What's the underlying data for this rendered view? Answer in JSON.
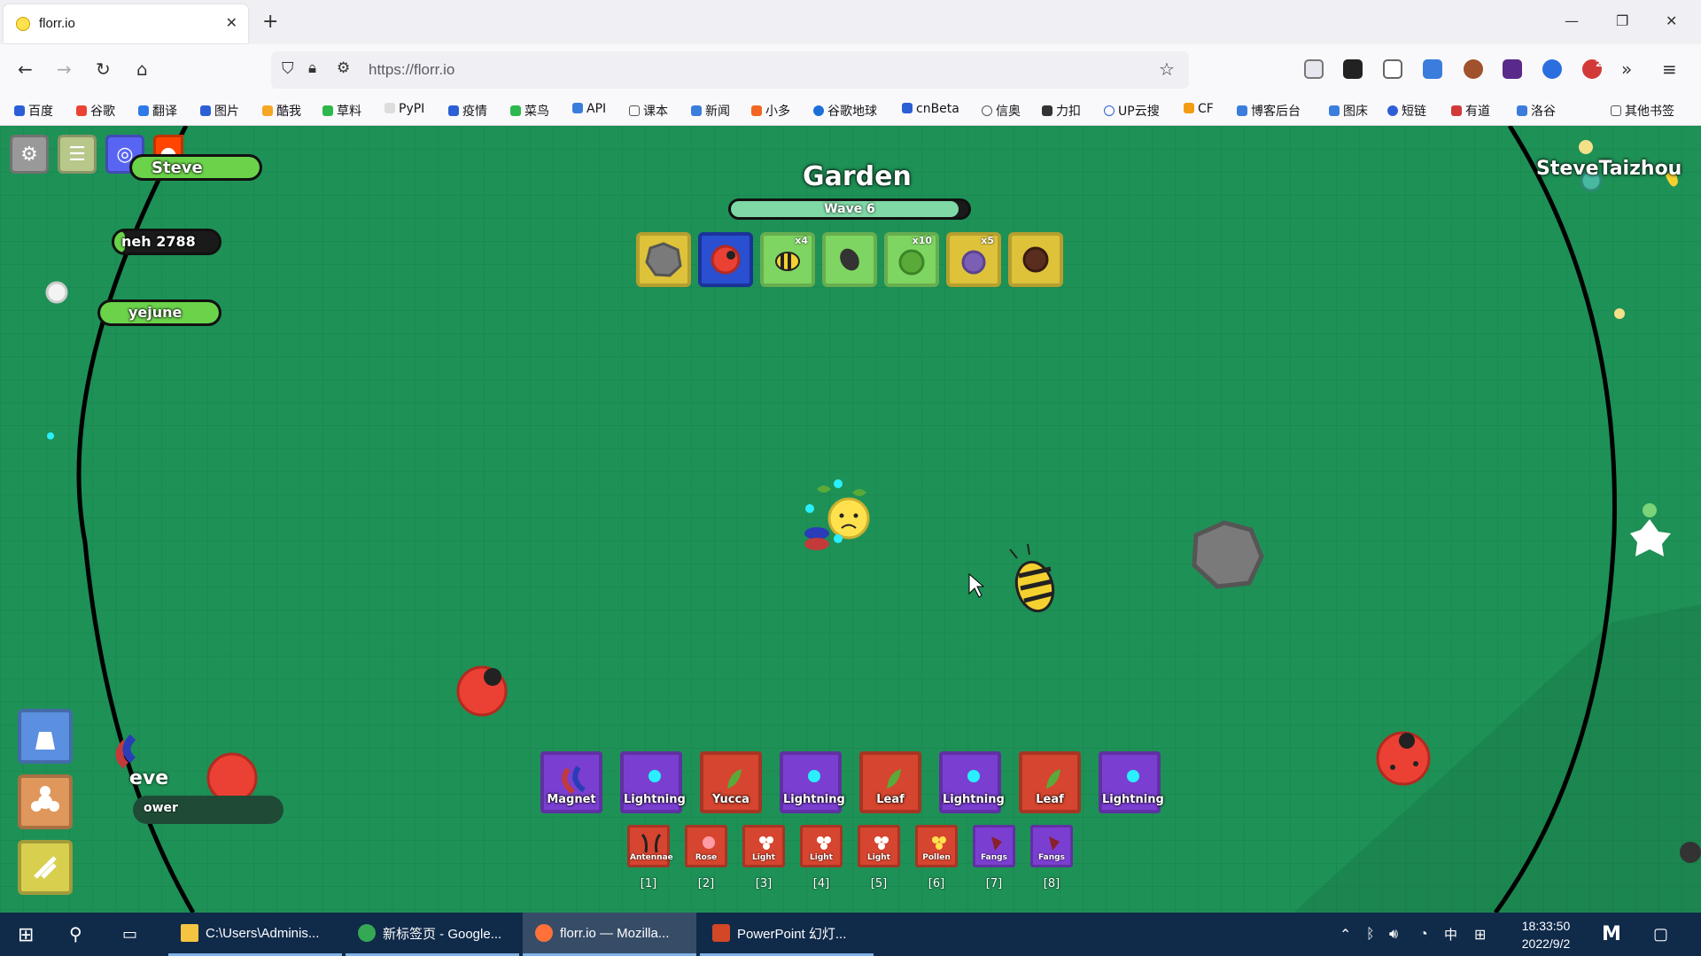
{
  "browser": {
    "tab_title": "florr.io",
    "tab_close": "✕",
    "new_tab": "+",
    "url": "https://florr.io",
    "window_controls": {
      "minimize": "—",
      "restore": "❐",
      "close": "✕"
    },
    "bookmarks": [
      "百度",
      "谷歌",
      "翻译",
      "图片",
      "酷我",
      "草料",
      "PyPI",
      "疫情",
      "菜鸟",
      "API",
      "课本",
      "新闻",
      "小多",
      "谷歌地球",
      "cnBeta",
      "信奥",
      "力扣",
      "UP云搜",
      "CF",
      "博客后台",
      "图床",
      "短链",
      "有道",
      "洛谷"
    ],
    "other_bookmarks": "其他书签",
    "extension_badge": "2"
  },
  "game": {
    "biome": "Garden",
    "wave": "Wave 6",
    "wave_progress": 0.96,
    "leaderboard": [
      "Steve",
      "neh 2788",
      "yejune"
    ],
    "player_panel": {
      "name": "eve",
      "subtitle": "ower"
    },
    "top_right_name": "SteveTaizhou",
    "mob_counts": [
      "x4",
      "x10",
      "x5"
    ],
    "main_slots": [
      {
        "label": "Magnet",
        "rarity": "epic"
      },
      {
        "label": "Lightning",
        "rarity": "epic"
      },
      {
        "label": "Yucca",
        "rarity": "mythic"
      },
      {
        "label": "Lightning",
        "rarity": "epic"
      },
      {
        "label": "Leaf",
        "rarity": "mythic"
      },
      {
        "label": "Lightning",
        "rarity": "epic"
      },
      {
        "label": "Leaf",
        "rarity": "mythic"
      },
      {
        "label": "Lightning",
        "rarity": "epic"
      }
    ],
    "secondary_slots": [
      {
        "label": "Antennae",
        "key": "[1]"
      },
      {
        "label": "Rose",
        "key": "[2]"
      },
      {
        "label": "Light",
        "key": "[3]"
      },
      {
        "label": "Light",
        "key": "[4]"
      },
      {
        "label": "Light",
        "key": "[5]"
      },
      {
        "label": "Pollen",
        "key": "[6]"
      },
      {
        "label": "Fangs",
        "key": "[7]"
      },
      {
        "label": "Fangs",
        "key": "[8]"
      }
    ],
    "colors": {
      "epic": "#7a3fd0",
      "mythic": "#d6452f",
      "field": "#1e9156",
      "unusual": "#ddc23a",
      "common": "#7ed562"
    }
  },
  "taskbar": {
    "apps": [
      "C:\\Users\\Adminis...",
      "新标签页 - Google...",
      "florr.io — Mozilla...",
      "PowerPoint 幻灯..."
    ],
    "tray": {
      "ime": "中"
    },
    "time": "18:33:50",
    "date": "2022/9/2"
  }
}
